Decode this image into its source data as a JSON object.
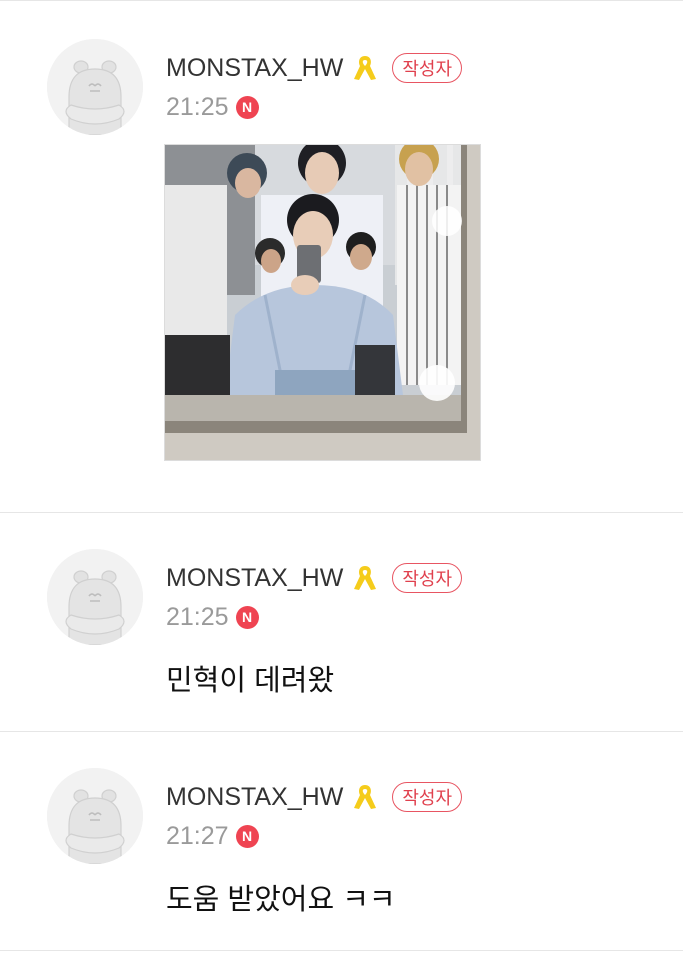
{
  "posts": [
    {
      "author": "MONSTAX_HW",
      "badge": "작성자",
      "time": "21:25",
      "new_badge": "N",
      "attachment": "photo"
    },
    {
      "author": "MONSTAX_HW",
      "badge": "작성자",
      "time": "21:25",
      "new_badge": "N",
      "text": "민혁이 데려왔"
    },
    {
      "author": "MONSTAX_HW",
      "badge": "작성자",
      "time": "21:27",
      "new_badge": "N",
      "text": "도움 받았어요 ㅋㅋ"
    }
  ],
  "colors": {
    "badge_red": "#e0404d",
    "new_badge_bg": "#ef4452",
    "ribbon_yellow": "#f5cc1b",
    "timestamp_gray": "#9a9a9a",
    "divider": "#e6e6e6"
  },
  "icons": {
    "ribbon": "yellow-ribbon-icon",
    "avatar": "default-profile-avatar"
  }
}
